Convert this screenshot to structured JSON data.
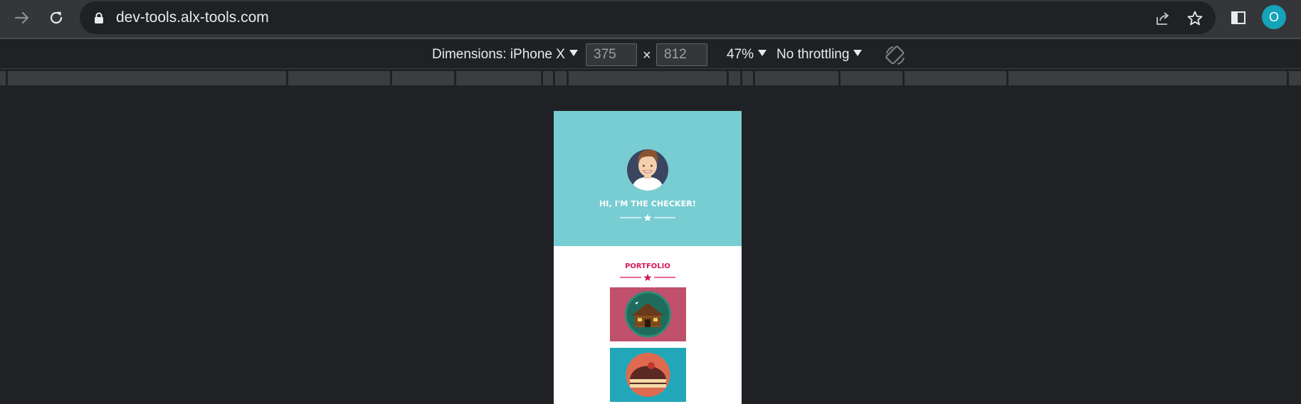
{
  "browser": {
    "url": "dev-tools.alx-tools.com",
    "profile_initial": "O",
    "icons": [
      "forward-icon",
      "reload-icon",
      "lock-icon",
      "share-icon",
      "bookmark-star-icon",
      "side-panel-icon"
    ]
  },
  "device_toolbar": {
    "dimensions_label": "Dimensions: iPhone X",
    "width_value": "375",
    "height_value": "812",
    "times": "×",
    "zoom": "47%",
    "throttling": "No throttling"
  },
  "page": {
    "hero_title": "HI, I'M THE CHECKER!",
    "section_title": "PORTFOLIO",
    "colors": {
      "hero_bg": "#78cdd2",
      "accent": "#d51b55",
      "tile_1_bg": "#c0516c",
      "tile_2_bg": "#22a7b8"
    },
    "portfolio_items": [
      {
        "icon": "cabin-icon"
      },
      {
        "icon": "cake-icon"
      }
    ]
  }
}
